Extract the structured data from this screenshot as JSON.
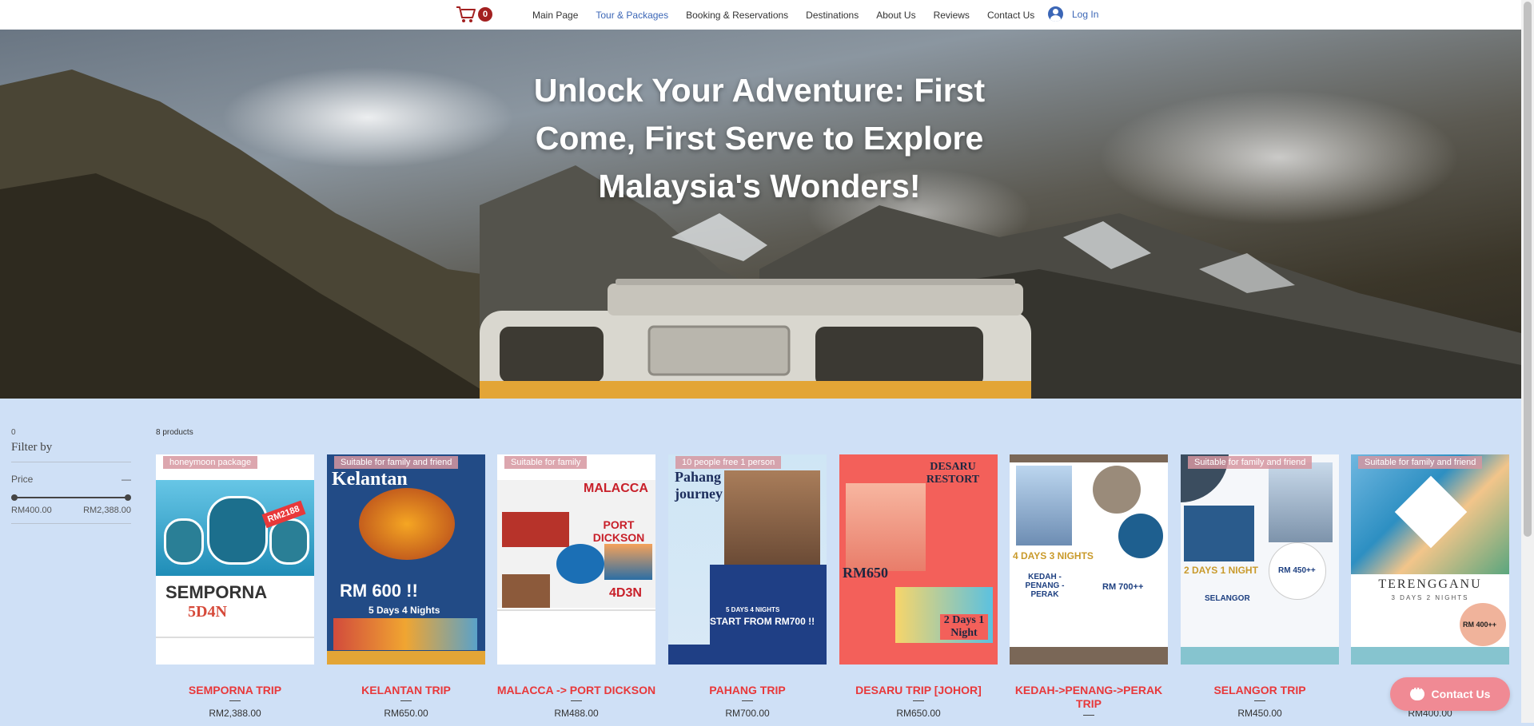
{
  "header": {
    "cart_count": "0",
    "nav": [
      "Main Page",
      "Tour & Packages",
      "Booking & Reservations",
      "Destinations",
      "About Us",
      "Reviews",
      "Contact Us"
    ],
    "active_nav": "Tour & Packages",
    "login": "Log In"
  },
  "hero": {
    "title": "Unlock Your Adventure: First Come, First Serve to Explore Malaysia's Wonders!"
  },
  "filter": {
    "count": "0",
    "label": "Filter by",
    "price_label": "Price",
    "collapse": "—",
    "min": "RM400.00",
    "max": "RM2,388.00"
  },
  "product_count": "8 products",
  "products": [
    {
      "name": "SEMPORNA TRIP",
      "price": "RM2,388.00",
      "ribbon": "honeymoon package",
      "poster_text": "SEMPORNA",
      "poster_sub": "5D4N",
      "poster_badge": "RM2188"
    },
    {
      "name": "KELANTAN TRIP",
      "price": "RM650.00",
      "ribbon": "Suitable for family and friend",
      "poster_text": "Kelantan",
      "poster_sub": "RM 600 !!",
      "poster_badge": "5 Days 4 Nights"
    },
    {
      "name": "MALACCA -> PORT DICKSON",
      "price": "RM488.00",
      "ribbon": "Suitable for family",
      "poster_text": "MALACCA",
      "poster_sub": "PORT DICKSON",
      "poster_badge": "4D3N"
    },
    {
      "name": "PAHANG TRIP",
      "price": "RM700.00",
      "ribbon": "10 people free 1 person",
      "poster_text": "Pahang journey",
      "poster_sub": "START FROM RM700 !!",
      "poster_badge": "5 DAYS 4 NIGHTS"
    },
    {
      "name": "DESARU TRIP [JOHOR]",
      "price": "RM650.00",
      "ribbon": "",
      "poster_text": "DESARU RESTORT",
      "poster_sub": "RM650",
      "poster_badge": "2 Days 1 Night"
    },
    {
      "name": "KEDAH->PENANG->PERAK TRIP",
      "price": "",
      "ribbon": "",
      "poster_text": "4 DAYS 3 NIGHTS",
      "poster_sub": "KEDAH - PENANG - PERAK",
      "poster_badge": "RM 700++"
    },
    {
      "name": "SELANGOR TRIP",
      "price": "RM450.00",
      "ribbon": "Suitable for family and friend",
      "poster_text": "2 DAYS 1 NIGHT",
      "poster_sub": "SELANGOR",
      "poster_badge": "RM 450++"
    },
    {
      "name": "TE",
      "price": "RM400.00",
      "ribbon": "Suitable for family and friend",
      "poster_text": "TERENGGANU",
      "poster_sub": "3 DAYS 2 NIGHTS",
      "poster_badge": "RM 400++"
    }
  ],
  "chat": {
    "label": "Contact Us"
  },
  "colors": {
    "accent": "#3b66b6",
    "product_name": "#e8383a",
    "chat": "#f08a94"
  }
}
